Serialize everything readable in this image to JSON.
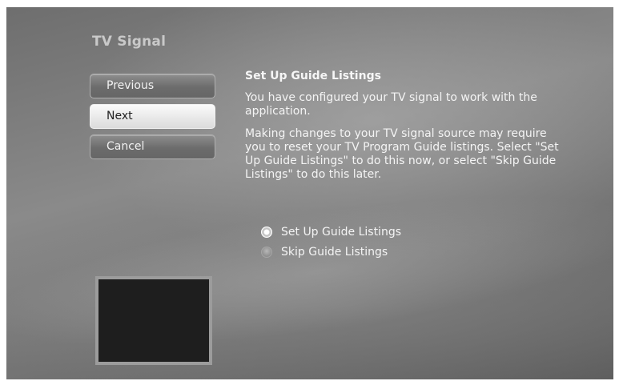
{
  "window": {
    "title": "TV Signal"
  },
  "nav": {
    "previous_label": "Previous",
    "next_label": "Next",
    "cancel_label": "Cancel",
    "focused": "Next"
  },
  "content": {
    "heading": "Set Up Guide Listings",
    "paragraph1": "You have configured your TV signal to work with the application.",
    "paragraph2": "Making changes to your TV signal source may require you to reset your TV Program Guide listings. Select \"Set Up Guide Listings\" to do this now, or select \"Skip Guide Listings\" to do this later."
  },
  "options": [
    {
      "label": "Set Up Guide Listings",
      "selected": true
    },
    {
      "label": "Skip Guide Listings",
      "selected": false
    }
  ],
  "colors": {
    "background": "#7a7a7a",
    "focused_button": "#eeeeee",
    "preview_background": "#1e1e1e"
  }
}
